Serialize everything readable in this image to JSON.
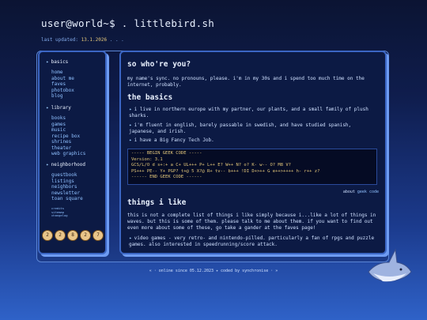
{
  "header": {
    "title": "user@world~$ . littlebird.sh"
  },
  "updated": {
    "label": "last updated:",
    "date": "13.1.2026",
    "dots": ". . ."
  },
  "sidebar": {
    "sections": [
      {
        "title": "basics",
        "items": [
          "home",
          "about me",
          "faves",
          "photobox",
          "blog"
        ]
      },
      {
        "title": "library",
        "items": [
          "books",
          "games",
          "music",
          "recipe box",
          "shrines",
          "theater",
          "web graphics"
        ]
      },
      {
        "title": "neighborhood",
        "items": [
          "guestbook",
          "listings",
          "neighbors",
          "newsletter",
          "toan square"
        ]
      }
    ],
    "tiny_links": [
      "credits",
      "sitemap",
      "changelog"
    ],
    "badges": [
      "2",
      "2",
      "8",
      "2",
      "7"
    ]
  },
  "main": {
    "heading1": "so who're you?",
    "intro": "my name's sync. no pronouns, please. i'm in my 30s and i spend too much time on the internet, probably.",
    "heading2": "the basics",
    "basics": [
      "i live in northern europe with my partner, our plants, and a small family of plush sharks.",
      "i'm fluent in english, barely passable in swedish, and have studied spanish, japanese, and irish.",
      "i have a Big Fancy Tech Job."
    ],
    "geek_code": [
      "----- BEGIN GEEK CODE -----",
      "Version: 3.1",
      "GCS/L/O d s+:+ a C+ UL+++ P+ L++ E? W++ N? o? K- w-- O? M8 V?",
      "PS+++ PE-- Y+ PGP? t+@ 5 X?@ R+ tv-- b+++ !DI D+>++ G e++>++++ h- r++ z?",
      "------ END GEEK CODE ------"
    ],
    "about_label": "about",
    "about_link": "geek code",
    "heading3": "things i like",
    "likes_intro": "this is not a complete list of things i like simply because i...like a lot of things in waves. but this is some of them. please talk to me about them. if you want to find out even more about some of these, go take a gander at the faves page!",
    "likes": [
      "video games - very retro- and nintendo-pilled. particularly a fan of rpgs and puzzle games. also interested in speedrunning/score attack."
    ]
  },
  "footer": {
    "text": "« · online since 05.12.2023 ✦ coded by synchronise · »"
  },
  "colors": {
    "accent": "#e4c77a",
    "link": "#8fc0ff",
    "panel": "#0c1a44",
    "border": "#3b66c4"
  }
}
